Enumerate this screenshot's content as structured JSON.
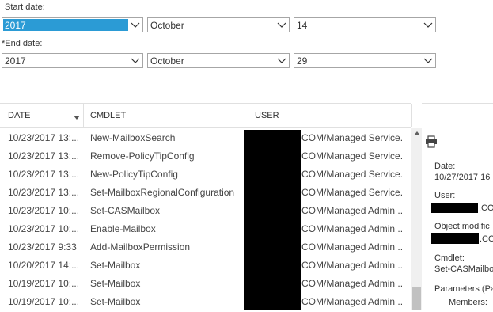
{
  "filters": {
    "start_label": "Start date:",
    "start_year": "2017",
    "start_month": "October",
    "start_day": "14",
    "end_label": "*End date:",
    "end_year": "2017",
    "end_month": "October",
    "end_day": "29"
  },
  "table": {
    "headers": [
      "DATE",
      "CMDLET",
      "USER"
    ],
    "rows": [
      {
        "date": "10/23/2017 13:...",
        "cmdlet": "New-MailboxSearch",
        "user": "COM/Managed Service..."
      },
      {
        "date": "10/23/2017 13:...",
        "cmdlet": "Remove-PolicyTipConfig",
        "user": "COM/Managed Service..."
      },
      {
        "date": "10/23/2017 13:...",
        "cmdlet": "New-PolicyTipConfig",
        "user": "COM/Managed Service..."
      },
      {
        "date": "10/23/2017 13:...",
        "cmdlet": "Set-MailboxRegionalConfiguration",
        "user": "COM/Managed Service..."
      },
      {
        "date": "10/23/2017 10:...",
        "cmdlet": "Set-CASMailbox",
        "user": "COM/Managed Admin ..."
      },
      {
        "date": "10/23/2017 10:...",
        "cmdlet": "Enable-Mailbox",
        "user": "COM/Managed Admin ..."
      },
      {
        "date": "10/23/2017 9:33",
        "cmdlet": "Add-MailboxPermission",
        "user": "COM/Managed Admin ..."
      },
      {
        "date": "10/20/2017 14:...",
        "cmdlet": "Set-Mailbox",
        "user": "COM/Managed Admin ..."
      },
      {
        "date": "10/19/2017 10:...",
        "cmdlet": "Set-Mailbox",
        "user": "COM/Managed Admin ..."
      },
      {
        "date": "10/19/2017 10:...",
        "cmdlet": "Set-Mailbox",
        "user": "COM/Managed Admin ..."
      }
    ]
  },
  "details": {
    "date_label": "Date:",
    "date_value": "10/27/2017 16",
    "user_label": "User:",
    "user_value": ".CO",
    "object_label": "Object modific",
    "object_value": ".CO",
    "cmdlet_label": "Cmdlet:",
    "cmdlet_value": "Set-CASMailbo",
    "params_label": "Parameters (Pa",
    "members_label": "Members:"
  },
  "colors": {
    "selection": "#2b9bd5",
    "redaction": "#000000",
    "border": "#a6a6a6"
  }
}
